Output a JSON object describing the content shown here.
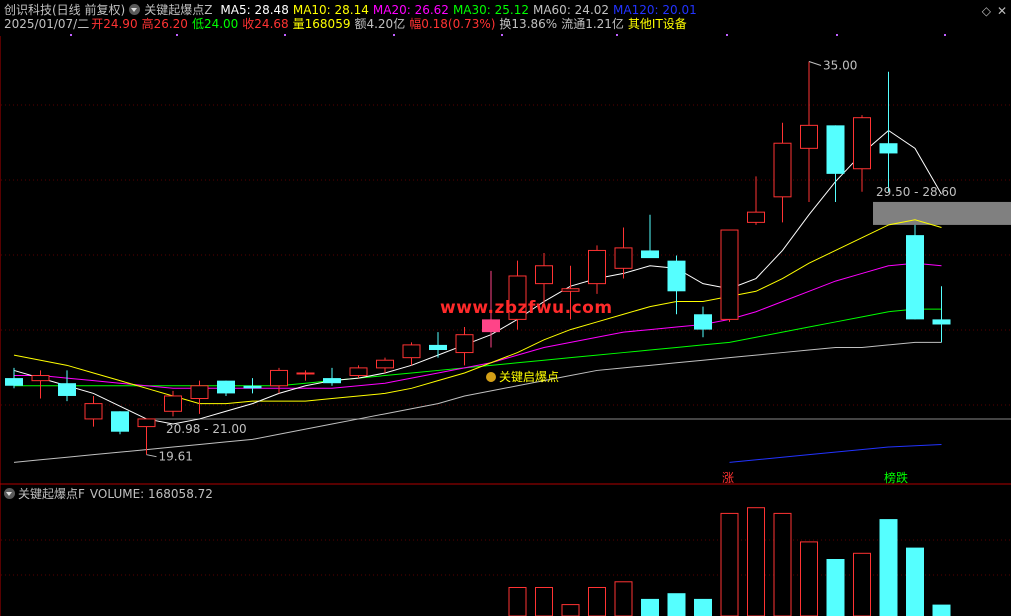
{
  "header": {
    "title": "创识科技(日线 前复权)",
    "indicator_main": "关键起爆点Z",
    "ma5": {
      "label": "MA5: 28.48",
      "color": "#ffffff"
    },
    "ma10": {
      "label": "MA10: 28.14",
      "color": "#ffff00"
    },
    "ma20": {
      "label": "MA20: 26.62",
      "color": "#ff00ff"
    },
    "ma30": {
      "label": "MA30: 25.12",
      "color": "#00ff00"
    },
    "ma60": {
      "label": "MA60: 24.02",
      "color": "#c0c0c0"
    },
    "ma120": {
      "label": "MA120: 20.01",
      "color": "#0000ff"
    }
  },
  "info": {
    "date": "2025/01/07/二",
    "open": "开24.90",
    "high": "高26.20",
    "low": "低24.00",
    "close": "收24.68",
    "volume": "量168059",
    "amount": "额4.20亿",
    "change": "幅0.18(0.73%)",
    "turnover": "换13.86%",
    "float": "流通1.21亿",
    "sector": "其他IT设备"
  },
  "volume_header": {
    "indicator": "关键起爆点F",
    "value": "VOLUME: 168058.72"
  },
  "watermark": "www.zbzfwu.com",
  "top_icons": [
    "diamond-icon",
    "close-icon"
  ],
  "chart_data": {
    "type": "candlestick",
    "price_range": [
      19.0,
      36.0
    ],
    "annotations": {
      "high_label": "35.00",
      "low_label": "19.61",
      "box_label_low": "20.98 - 21.00",
      "box_label_high": "29.50 - 28.60",
      "signal_label": "关键启爆点",
      "tag_zhang": "涨",
      "tag_bangdie": "榜跌"
    },
    "candles": [
      {
        "o": 22.6,
        "h": 23.0,
        "l": 22.2,
        "c": 22.3
      },
      {
        "o": 22.5,
        "h": 22.9,
        "l": 21.8,
        "c": 22.7
      },
      {
        "o": 22.4,
        "h": 22.9,
        "l": 21.7,
        "c": 21.9
      },
      {
        "o": 21.0,
        "h": 21.9,
        "l": 20.7,
        "c": 21.6
      },
      {
        "o": 21.3,
        "h": 21.3,
        "l": 20.4,
        "c": 20.5
      },
      {
        "o": 20.7,
        "h": 21.0,
        "l": 19.6,
        "c": 21.0
      },
      {
        "o": 21.3,
        "h": 22.1,
        "l": 21.1,
        "c": 21.9
      },
      {
        "o": 21.8,
        "h": 22.5,
        "l": 21.2,
        "c": 22.3
      },
      {
        "o": 22.5,
        "h": 22.5,
        "l": 21.9,
        "c": 22.0
      },
      {
        "o": 22.3,
        "h": 22.6,
        "l": 22.0,
        "c": 22.2
      },
      {
        "o": 22.3,
        "h": 23.0,
        "l": 22.0,
        "c": 22.9
      },
      {
        "o": 22.8,
        "h": 22.9,
        "l": 22.5,
        "c": 22.8
      },
      {
        "o": 22.6,
        "h": 23.0,
        "l": 22.3,
        "c": 22.4
      },
      {
        "o": 22.7,
        "h": 23.1,
        "l": 22.6,
        "c": 23.0
      },
      {
        "o": 23.0,
        "h": 23.4,
        "l": 22.8,
        "c": 23.3
      },
      {
        "o": 23.4,
        "h": 24.0,
        "l": 23.1,
        "c": 23.9
      },
      {
        "o": 23.9,
        "h": 24.4,
        "l": 23.4,
        "c": 23.7
      },
      {
        "o": 23.6,
        "h": 24.6,
        "l": 23.1,
        "c": 24.3
      },
      {
        "o": 24.4,
        "h": 26.8,
        "l": 23.8,
        "c": 24.9
      },
      {
        "o": 24.9,
        "h": 27.2,
        "l": 24.5,
        "c": 26.6
      },
      {
        "o": 26.3,
        "h": 27.5,
        "l": 25.4,
        "c": 27.0
      },
      {
        "o": 26.0,
        "h": 27.0,
        "l": 24.9,
        "c": 26.1
      },
      {
        "o": 26.3,
        "h": 27.8,
        "l": 25.9,
        "c": 27.6
      },
      {
        "o": 26.9,
        "h": 28.5,
        "l": 26.5,
        "c": 27.7
      },
      {
        "o": 27.6,
        "h": 29.0,
        "l": 27.4,
        "c": 27.3
      },
      {
        "o": 27.2,
        "h": 27.4,
        "l": 25.1,
        "c": 26.0
      },
      {
        "o": 25.1,
        "h": 25.4,
        "l": 24.2,
        "c": 24.5
      },
      {
        "o": 24.9,
        "h": 28.4,
        "l": 24.8,
        "c": 28.4
      },
      {
        "o": 28.7,
        "h": 30.5,
        "l": 28.6,
        "c": 29.1
      },
      {
        "o": 29.7,
        "h": 32.6,
        "l": 28.7,
        "c": 31.8
      },
      {
        "o": 31.6,
        "h": 35.0,
        "l": 29.5,
        "c": 32.5
      },
      {
        "o": 32.5,
        "h": 32.5,
        "l": 29.5,
        "c": 30.6
      },
      {
        "o": 30.8,
        "h": 32.9,
        "l": 29.9,
        "c": 32.8
      },
      {
        "o": 31.8,
        "h": 34.6,
        "l": 29.9,
        "c": 31.4
      },
      {
        "o": 28.2,
        "h": 28.6,
        "l": 24.9,
        "c": 24.9
      },
      {
        "o": 24.9,
        "h": 26.2,
        "l": 24.0,
        "c": 24.7
      }
    ],
    "ma5": [
      22.9,
      22.6,
      22.3,
      22.0,
      21.5,
      21.0,
      20.8,
      21.0,
      21.3,
      21.6,
      22.0,
      22.3,
      22.5,
      22.6,
      22.8,
      23.1,
      23.5,
      23.9,
      24.3,
      24.9,
      25.6,
      26.2,
      26.5,
      26.7,
      27.0,
      26.9,
      26.3,
      26.1,
      26.5,
      27.6,
      29.0,
      30.3,
      31.4,
      32.3,
      31.6,
      29.8
    ],
    "ma10": [
      23.5,
      23.3,
      23.1,
      22.8,
      22.5,
      22.2,
      21.9,
      21.6,
      21.6,
      21.7,
      21.7,
      21.7,
      21.8,
      21.9,
      22.0,
      22.2,
      22.5,
      22.8,
      23.2,
      23.6,
      24.1,
      24.5,
      24.8,
      25.1,
      25.4,
      25.6,
      25.6,
      25.8,
      26.0,
      26.5,
      27.1,
      27.6,
      28.1,
      28.6,
      28.8,
      28.5
    ],
    "ma20": [
      22.7,
      22.7,
      22.6,
      22.5,
      22.4,
      22.3,
      22.2,
      22.2,
      22.2,
      22.2,
      22.2,
      22.2,
      22.2,
      22.3,
      22.4,
      22.6,
      22.8,
      23.0,
      23.2,
      23.5,
      23.8,
      24.0,
      24.2,
      24.4,
      24.5,
      24.6,
      24.7,
      24.9,
      25.2,
      25.6,
      26.0,
      26.4,
      26.7,
      27.0,
      27.1,
      27.0
    ],
    "ma30": [
      22.3,
      22.3,
      22.3,
      22.3,
      22.3,
      22.3,
      22.3,
      22.3,
      22.3,
      22.3,
      22.3,
      22.4,
      22.5,
      22.6,
      22.7,
      22.8,
      22.9,
      23.0,
      23.1,
      23.2,
      23.3,
      23.4,
      23.5,
      23.6,
      23.7,
      23.8,
      23.9,
      24.0,
      24.2,
      24.4,
      24.6,
      24.8,
      25.0,
      25.2,
      25.3,
      25.3
    ],
    "ma60": [
      19.3,
      19.4,
      19.5,
      19.6,
      19.7,
      19.8,
      19.9,
      20.0,
      20.1,
      20.2,
      20.4,
      20.6,
      20.8,
      21.0,
      21.2,
      21.4,
      21.6,
      21.9,
      22.1,
      22.3,
      22.5,
      22.7,
      22.9,
      23.0,
      23.1,
      23.2,
      23.3,
      23.4,
      23.5,
      23.6,
      23.7,
      23.8,
      23.8,
      23.9,
      24.0,
      24.0
    ],
    "ma120_points": [
      {
        "i": 27,
        "v": 19.3
      },
      {
        "i": 30,
        "v": 19.6
      },
      {
        "i": 33,
        "v": 19.9
      },
      {
        "i": 35,
        "v": 20.0
      }
    ],
    "volumes": [
      0,
      0,
      0,
      0,
      0,
      0,
      0,
      0,
      0,
      0,
      0,
      0,
      0,
      0,
      0,
      0,
      0,
      0,
      0,
      5,
      5,
      2,
      5,
      6,
      3,
      4,
      3,
      18,
      19,
      18,
      13,
      10,
      11,
      17,
      12,
      2
    ]
  }
}
